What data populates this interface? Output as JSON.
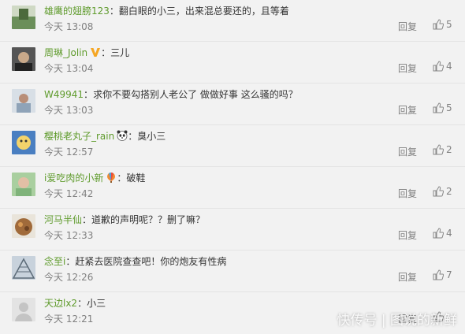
{
  "comments": [
    {
      "user": "雄鹰的翅膀123",
      "sep": "：",
      "text": "翻白眼的小三，出来混总要还的，且等着",
      "time": "今天 13:08",
      "reply": "回复",
      "likes": "5",
      "avatar_color": "#6b8f5a",
      "badge": ""
    },
    {
      "user": "周琳_Jolin",
      "sep": "：",
      "text": "三儿",
      "time": "今天 13:04",
      "reply": "回复",
      "likes": "4",
      "avatar_color": "#3a3a3a",
      "badge": "V"
    },
    {
      "user": "W49941",
      "sep": "：",
      "text": "求你不要勾搭别人老公了 做做好事 这么骚的吗？",
      "time": "今天 13:03",
      "reply": "回复",
      "likes": "5",
      "avatar_color": "#8fa3b8",
      "badge": ""
    },
    {
      "user": "樱桃老丸子_rain",
      "sep": "：",
      "text": "臭小三",
      "time": "今天 12:57",
      "reply": "回复",
      "likes": "2",
      "avatar_color": "#4a7fc1",
      "badge": "panda"
    },
    {
      "user": "i爱吃肉的小新",
      "sep": "：",
      "text": "破鞋",
      "time": "今天 12:42",
      "reply": "回复",
      "likes": "2",
      "avatar_color": "#7fb37a",
      "badge": "balloon"
    },
    {
      "user": "河马半仙",
      "sep": "：",
      "text": "道歉的声明呢？？删了嘛？",
      "time": "今天 12:33",
      "reply": "回复",
      "likes": "4",
      "avatar_color": "#a06a3a",
      "badge": ""
    },
    {
      "user": "念至i",
      "sep": "：",
      "text": "赶紧去医院查查吧！你的炮友有性病",
      "time": "今天 12:26",
      "reply": "回复",
      "likes": "7",
      "avatar_color": "#9aa7b4",
      "badge": ""
    },
    {
      "user": "天边lx2",
      "sep": "：",
      "text": "小三",
      "time": "今天 12:21",
      "reply": "回复",
      "likes": "",
      "avatar_color": "#d6d6d6",
      "badge": ""
    }
  ],
  "watermark": "快传号 | 图说的新鲜"
}
